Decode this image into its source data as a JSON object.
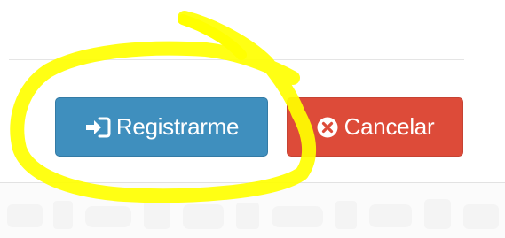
{
  "form_actions": {
    "register_label": "Registrarme",
    "register_icon": "sign-in-icon",
    "cancel_label": "Cancelar",
    "cancel_icon": "times-circle-icon"
  },
  "colors": {
    "register_button": "#3f8fbe",
    "cancel_button": "#dd4b39",
    "highlight_annotation": "#ffff00"
  }
}
